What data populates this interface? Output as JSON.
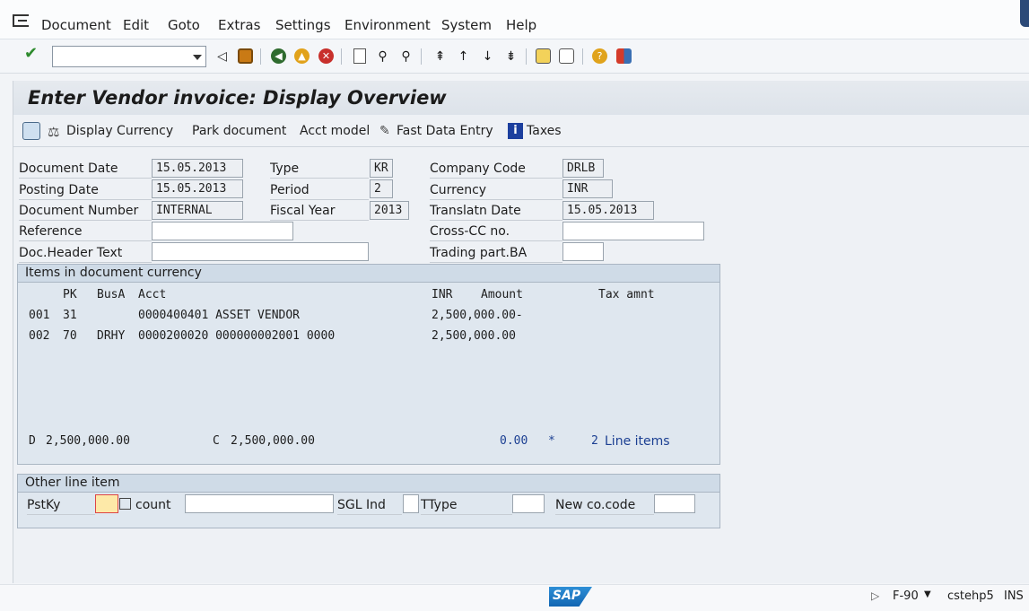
{
  "menu": {
    "items": [
      "Document",
      "Edit",
      "Goto",
      "Extras",
      "Settings",
      "Environment",
      "System",
      "Help"
    ]
  },
  "toolbar": {
    "command_value": "",
    "icons": [
      "enter-icon",
      "back-icon",
      "save-icon",
      "back-green-icon",
      "exit-icon",
      "cancel-icon",
      "print-icon",
      "find-icon",
      "find-next-icon",
      "first-page-icon",
      "prev-page-icon",
      "next-page-icon",
      "last-page-icon",
      "new-session-icon",
      "shortcut-icon",
      "help-icon",
      "layout-icon"
    ]
  },
  "screen": {
    "title": "Enter Vendor invoice: Display Overview"
  },
  "app_toolbar": {
    "display_currency": "Display Currency",
    "park_document": "Park document",
    "acct_model": "Acct model",
    "fast_data_entry": "Fast Data Entry",
    "taxes": "Taxes"
  },
  "header": {
    "document_date_label": "Document Date",
    "document_date": "15.05.2013",
    "posting_date_label": "Posting Date",
    "posting_date": "15.05.2013",
    "document_number_label": "Document Number",
    "document_number": "INTERNAL",
    "reference_label": "Reference",
    "reference": "",
    "doc_header_text_label": "Doc.Header Text",
    "doc_header_text": "",
    "type_label": "Type",
    "type": "KR",
    "period_label": "Period",
    "period": "2",
    "fiscal_year_label": "Fiscal Year",
    "fiscal_year": "2013",
    "company_code_label": "Company Code",
    "company_code": "DRLB",
    "currency_label": "Currency",
    "currency": "INR",
    "translatn_date_label": "Translatn Date",
    "translatn_date": "15.05.2013",
    "cross_cc_label": "Cross-CC no.",
    "cross_cc": "",
    "trading_part_label": "Trading part.BA",
    "trading_part": ""
  },
  "items_panel": {
    "title": "Items in document currency",
    "col_pk": "PK",
    "col_busa": "BusA",
    "col_acct": "Acct",
    "col_inr": "INR",
    "col_amount": "Amount",
    "col_tax": "Tax amnt",
    "rows": [
      {
        "no": "001",
        "pk": "31",
        "busa": "",
        "acct": "0000400401 ASSET VENDOR",
        "amount": "2,500,000.00-"
      },
      {
        "no": "002",
        "pk": "70",
        "busa": "DRHY",
        "acct": "0000200020 000000002001 0000",
        "amount": "2,500,000.00"
      }
    ],
    "debit_marker": "D",
    "debit_total": "2,500,000.00",
    "credit_marker": "C",
    "credit_total": "2,500,000.00",
    "balance": "0.00",
    "balance_flag": "*",
    "line_count": "2",
    "line_items_label": "Line items"
  },
  "other_panel": {
    "title": "Other line item",
    "pstky_label": "PstKy",
    "pstky": "",
    "account_label": "count",
    "account": "",
    "sgl_label": "SGL Ind",
    "sgl": "",
    "ttype_label": "TType",
    "ttype": "",
    "new_cocode_label": "New co.code",
    "new_cocode": ""
  },
  "status": {
    "transaction": "F-90",
    "system": "cstehp5",
    "mode": "INS",
    "logo": "SAP"
  }
}
